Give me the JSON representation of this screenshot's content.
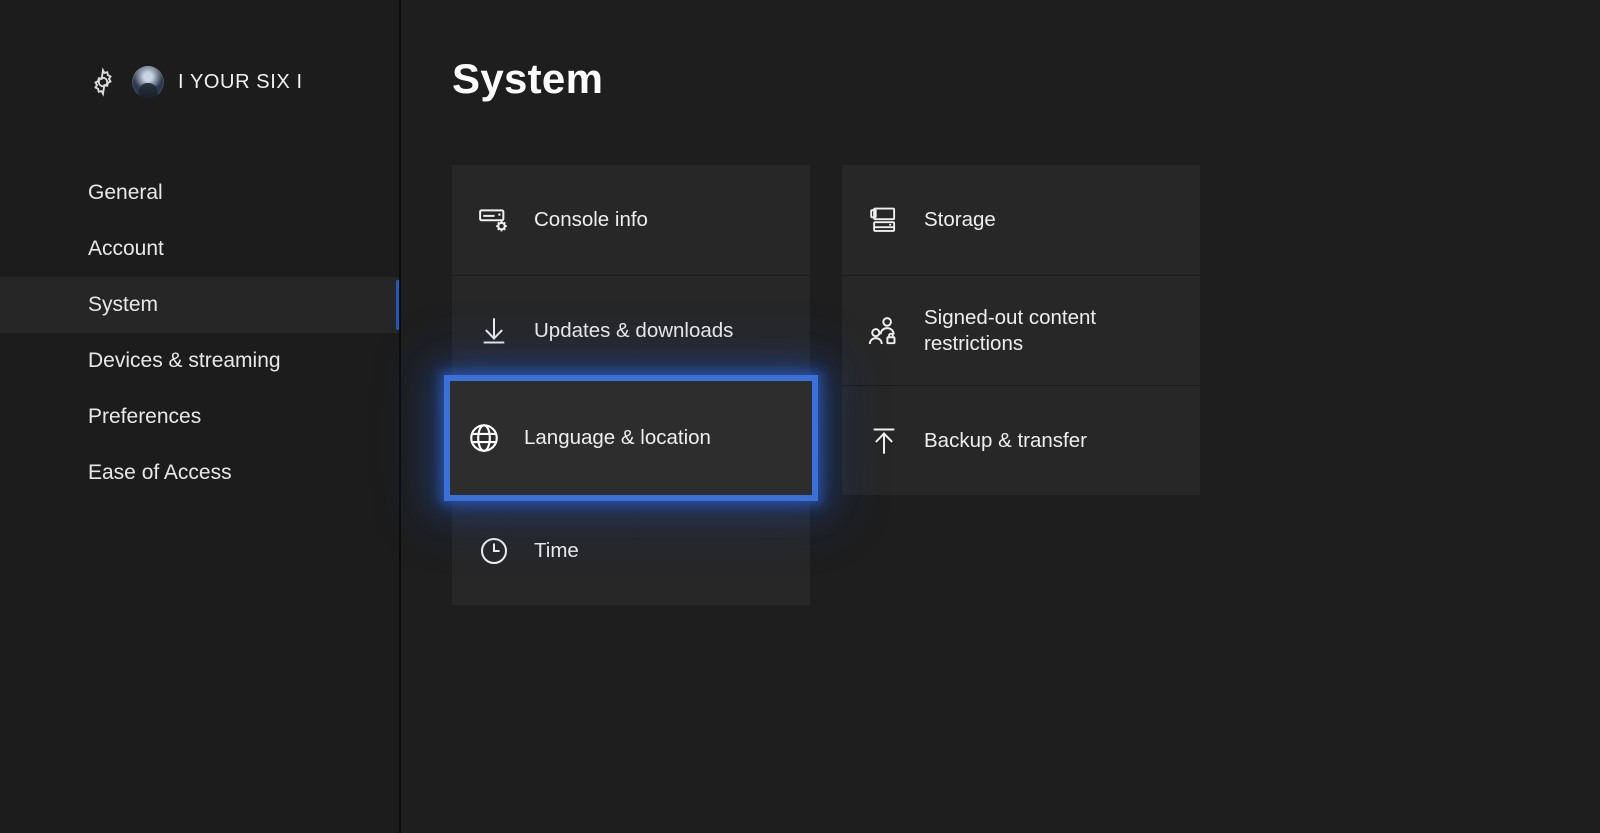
{
  "sidebar": {
    "profile": {
      "gear_icon": "gear-icon",
      "avatar_icon": "avatar",
      "gamertag": "I YOUR SIX I"
    },
    "items": [
      {
        "label": "General",
        "selected": false
      },
      {
        "label": "Account",
        "selected": false
      },
      {
        "label": "System",
        "selected": true
      },
      {
        "label": "Devices & streaming",
        "selected": false
      },
      {
        "label": "Preferences",
        "selected": false
      },
      {
        "label": "Ease of Access",
        "selected": false
      }
    ]
  },
  "main": {
    "title": "System",
    "columns": [
      {
        "tiles": [
          {
            "label": "Console info",
            "icon": "console-gear-icon",
            "focused": false
          },
          {
            "label": "Updates & downloads",
            "icon": "download-arrow-icon",
            "focused": false
          },
          {
            "label": "Language & location",
            "icon": "globe-icon",
            "focused": true
          },
          {
            "label": "Time",
            "icon": "clock-icon",
            "focused": false
          }
        ]
      },
      {
        "tiles": [
          {
            "label": "Storage",
            "icon": "storage-drives-icon",
            "focused": false
          },
          {
            "label": "Signed-out content restrictions",
            "icon": "people-lock-icon",
            "focused": false
          },
          {
            "label": "Backup & transfer",
            "icon": "upload-arrow-icon",
            "focused": false
          }
        ]
      }
    ]
  },
  "colors": {
    "background": "#1e1e1e",
    "sidebar_background": "#1c1c1c",
    "tile_background": "#272727",
    "selected_row_background": "#262626",
    "accent_blue": "#1c5cc0",
    "focus_border_blue": "#3a70d8",
    "text_primary": "#eeeeee"
  }
}
